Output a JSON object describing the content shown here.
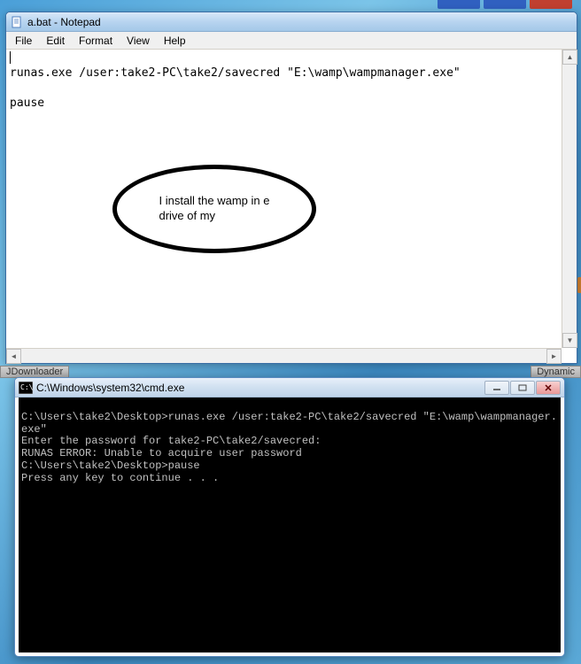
{
  "notepad": {
    "title": "a.bat - Notepad",
    "menu": {
      "file": "File",
      "edit": "Edit",
      "format": "Format",
      "view": "View",
      "help": "Help"
    },
    "content_line1": "",
    "content_line2": "runas.exe /user:take2-PC\\take2/savecred \"E:\\wamp\\wampmanager.exe\"",
    "content_line3": "",
    "content_line4": "pause"
  },
  "annotation": {
    "line1": "I install the wamp in e",
    "line2": "drive of my"
  },
  "taskbar": {
    "left_label": "JDownloader",
    "right_label": "Dynamic"
  },
  "cmd": {
    "title": "C:\\Windows\\system32\\cmd.exe",
    "output": "\nC:\\Users\\take2\\Desktop>runas.exe /user:take2-PC\\take2/savecred \"E:\\wamp\\wampmanager.exe\"\nEnter the password for take2-PC\\take2/savecred:\nRUNAS ERROR: Unable to acquire user password\nC:\\Users\\take2\\Desktop>pause\nPress any key to continue . . ."
  }
}
